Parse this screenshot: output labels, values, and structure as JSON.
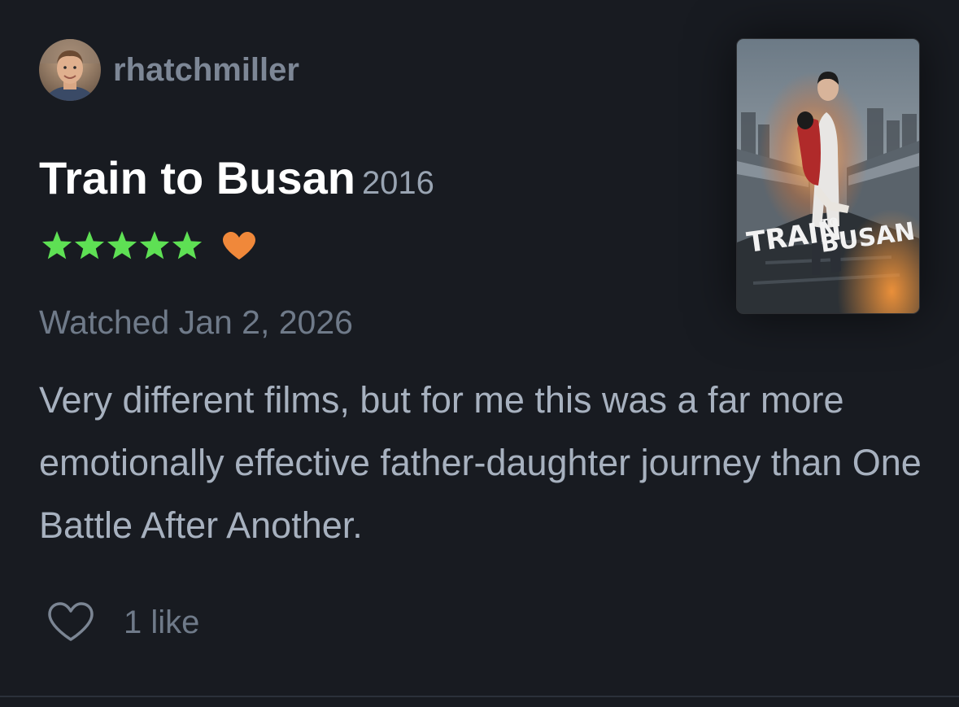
{
  "review": {
    "username": "rhatchmiller",
    "film_title": "Train to Busan",
    "film_year": "2016",
    "rating_stars": 5,
    "liked": true,
    "watched_date": "Watched Jan 2, 2026",
    "text": "Very different films, but for me this was a far more emotionally effective father-daughter journey than One Battle After Another.",
    "likes_label": "1 like"
  },
  "poster": {
    "title_main": "TRAIN",
    "title_small": "TO",
    "title_second": "BUSAN"
  },
  "colors": {
    "background": "#181b21",
    "star": "#5ee054",
    "heart": "#f0883a",
    "username": "#7d8796",
    "muted": "#6f7a89",
    "body_text": "#a7b1bf"
  },
  "icons": {
    "rating": "star-icon",
    "liked": "heart-filled-icon",
    "like_action": "heart-outline-icon"
  }
}
